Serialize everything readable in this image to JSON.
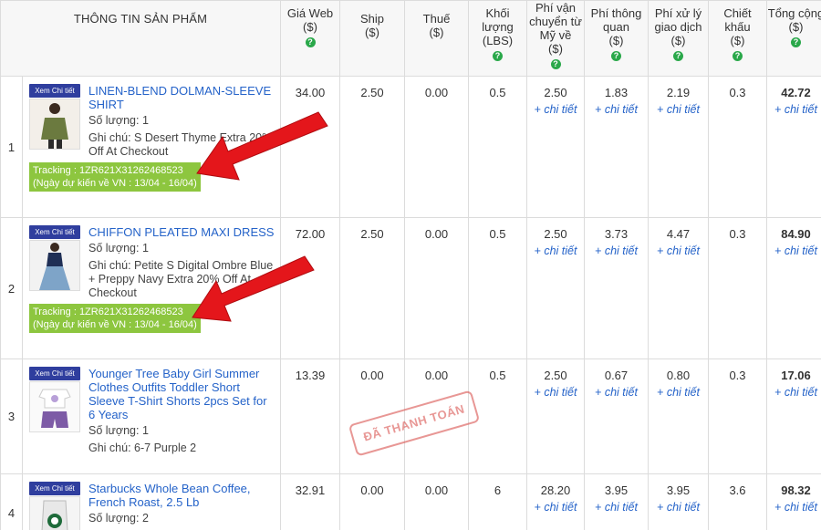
{
  "header": {
    "product_info": "THÔNG TIN SẢN PHẨM",
    "web_price": [
      "Giá Web",
      "($)"
    ],
    "ship": [
      "Ship",
      "($)"
    ],
    "tax": [
      "Thuế",
      "($)"
    ],
    "weight": [
      "Khối",
      "lượng",
      "(LBS)"
    ],
    "us_shipping": [
      "Phí vận",
      "chuyển từ",
      "Mỹ về",
      "($)"
    ],
    "customs": [
      "Phí thông",
      "quan",
      "($)"
    ],
    "processing": [
      "Phí xử lý",
      "giao dịch",
      "($)"
    ],
    "discount": [
      "Chiết",
      "khấu",
      "($)"
    ],
    "total": [
      "Tổng cộng",
      "($)"
    ],
    "help_glyph": "?"
  },
  "detail_link": "+ chi tiết",
  "view_detail_label": "Xem Chi tiết",
  "stamp_text": "ĐÃ THANH TOÁN",
  "colors": {
    "link": "#2563c9",
    "tracking_bg": "#8dc63f",
    "detail_btn": "#2f3e9e",
    "arrow": "#e4161b",
    "help": "#2aa84a"
  },
  "rows": [
    {
      "index": "1",
      "title": "LINEN-BLEND DOLMAN-SLEEVE SHIRT",
      "qty": "Số lượng: 1",
      "note": "Ghi chú: S Desert Thyme Extra 20% Off At Checkout",
      "tracking": "Tracking : 1ZR621X31262468523",
      "eta": "(Ngày dự kiến về VN : 13/04 - 16/04)",
      "web_price": "34.00",
      "ship": "2.50",
      "tax": "0.00",
      "weight": "0.5",
      "us_shipping": "2.50",
      "customs": "1.83",
      "processing": "2.19",
      "discount": "0.3",
      "total": "42.72"
    },
    {
      "index": "2",
      "title": "CHIFFON PLEATED MAXI DRESS",
      "qty": "Số lượng: 1",
      "note": "Ghi chú: Petite S Digital Ombre Blue + Preppy Navy Extra 20% Off At Checkout",
      "tracking": "Tracking : 1ZR621X31262468523",
      "eta": "(Ngày dự kiến về VN : 13/04 - 16/04)",
      "web_price": "72.00",
      "ship": "2.50",
      "tax": "0.00",
      "weight": "0.5",
      "us_shipping": "2.50",
      "customs": "3.73",
      "processing": "4.47",
      "discount": "0.3",
      "total": "84.90"
    },
    {
      "index": "3",
      "title": "Younger Tree Baby Girl Summer Clothes Outfits Toddler Short Sleeve T-Shirt Shorts 2pcs Set for 6 Years",
      "qty": "Số lượng: 1",
      "note": "Ghi chú: 6-7 Purple 2",
      "web_price": "13.39",
      "ship": "0.00",
      "tax": "0.00",
      "weight": "0.5",
      "us_shipping": "2.50",
      "customs": "0.67",
      "processing": "0.80",
      "discount": "0.3",
      "total": "17.06"
    },
    {
      "index": "4",
      "title": "Starbucks Whole Bean Coffee, French Roast, 2.5 Lb",
      "qty": "Số lượng: 2",
      "web_price": "32.91",
      "ship": "0.00",
      "tax": "0.00",
      "weight": "6",
      "us_shipping": "28.20",
      "customs": "3.95",
      "processing": "3.95",
      "discount": "3.6",
      "total": "98.32"
    }
  ]
}
